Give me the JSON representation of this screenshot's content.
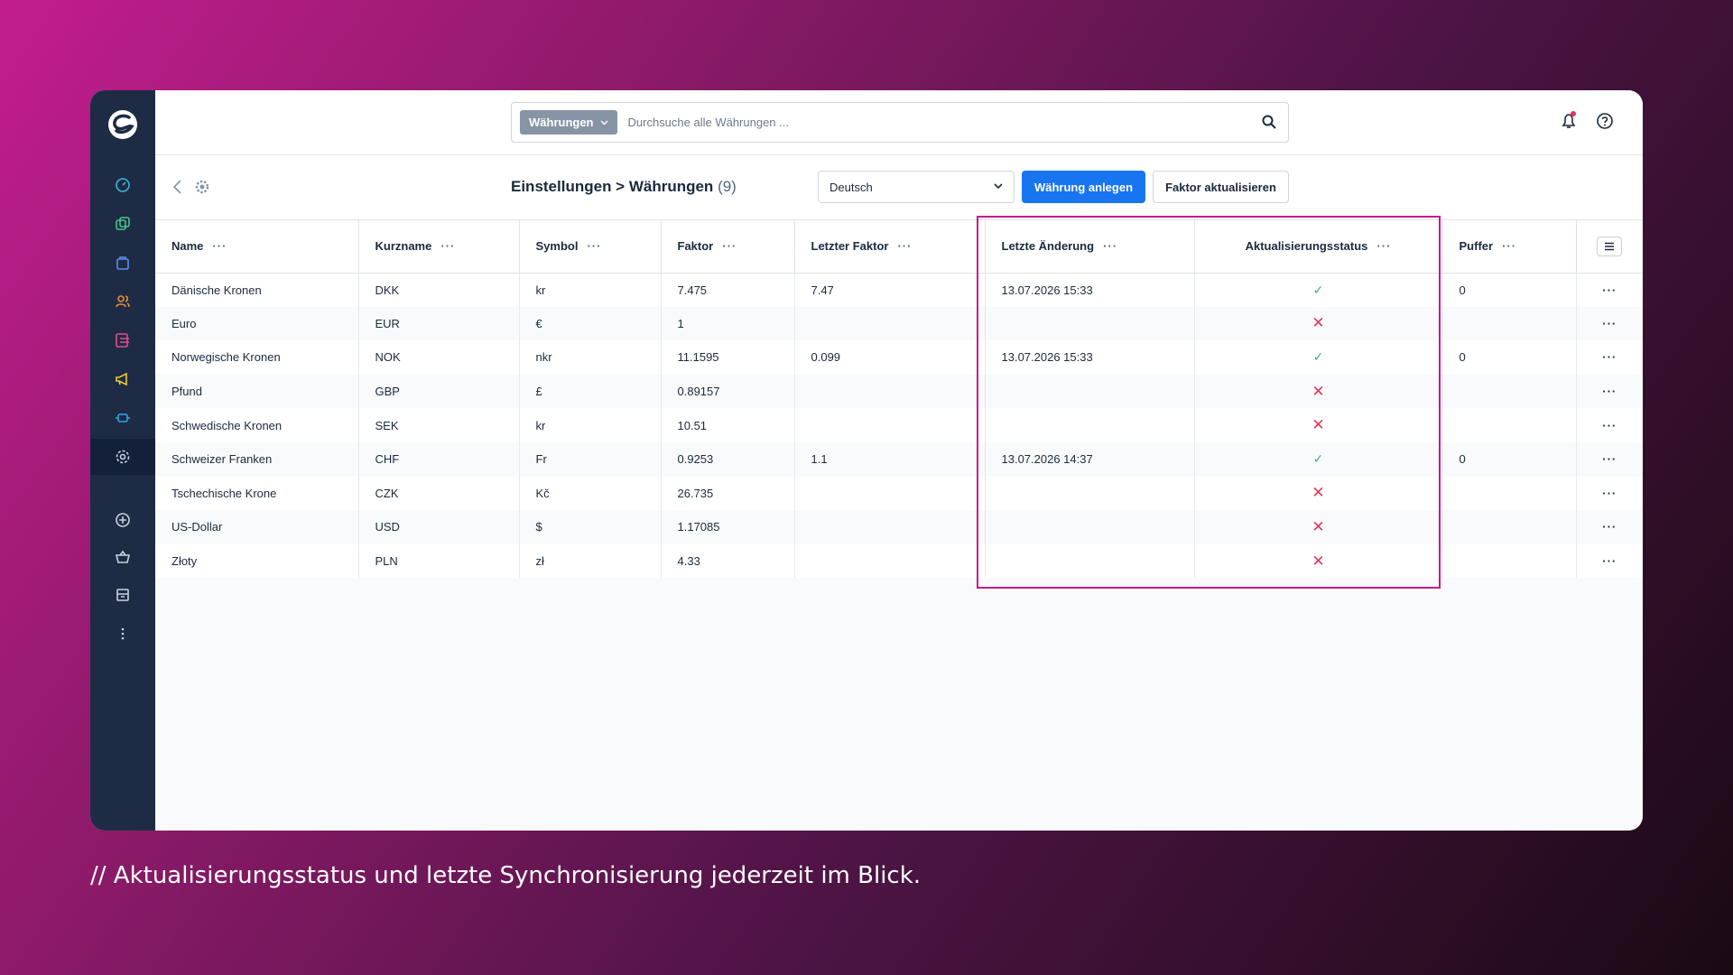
{
  "search": {
    "type_label": "Währungen",
    "placeholder": "Durchsuche alle Währungen ..."
  },
  "page": {
    "title": "Einstellungen > Währungen",
    "count": "(9)"
  },
  "language_select": {
    "value": "Deutsch"
  },
  "buttons": {
    "create": "Währung anlegen",
    "update_factor": "Faktor aktualisieren"
  },
  "table": {
    "columns": [
      "Name",
      "Kurzname",
      "Symbol",
      "Faktor",
      "Letzter Faktor",
      "Letzte Änderung",
      "Aktualisierungsstatus",
      "Puffer"
    ],
    "column_menu": "···",
    "rows": [
      {
        "name": "Dänische Kronen",
        "short": "DKK",
        "symbol": "kr",
        "factor": "7.475",
        "last_factor": "7.47",
        "last_change": "13.07.2026 15:33",
        "status": "ok",
        "buffer": "0"
      },
      {
        "name": "Euro",
        "short": "EUR",
        "symbol": "€",
        "factor": "1",
        "last_factor": "",
        "last_change": "",
        "status": "fail",
        "buffer": ""
      },
      {
        "name": "Norwegische Kronen",
        "short": "NOK",
        "symbol": "nkr",
        "factor": "11.1595",
        "last_factor": "0.099",
        "last_change": "13.07.2026 15:33",
        "status": "ok",
        "buffer": "0"
      },
      {
        "name": "Pfund",
        "short": "GBP",
        "symbol": "£",
        "factor": "0.89157",
        "last_factor": "",
        "last_change": "",
        "status": "fail",
        "buffer": ""
      },
      {
        "name": "Schwedische Kronen",
        "short": "SEK",
        "symbol": "kr",
        "factor": "10.51",
        "last_factor": "",
        "last_change": "",
        "status": "fail",
        "buffer": ""
      },
      {
        "name": "Schweizer Franken",
        "short": "CHF",
        "symbol": "Fr",
        "factor": "0.9253",
        "last_factor": "1.1",
        "last_change": "13.07.2026 14:37",
        "status": "ok",
        "buffer": "0"
      },
      {
        "name": "Tschechische Krone",
        "short": "CZK",
        "symbol": "Kč",
        "factor": "26.735",
        "last_factor": "",
        "last_change": "",
        "status": "fail",
        "buffer": ""
      },
      {
        "name": "US-Dollar",
        "short": "USD",
        "symbol": "$",
        "factor": "1.17085",
        "last_factor": "",
        "last_change": "",
        "status": "fail",
        "buffer": ""
      },
      {
        "name": "Złoty",
        "short": "PLN",
        "symbol": "zł",
        "factor": "4.33",
        "last_factor": "",
        "last_change": "",
        "status": "fail",
        "buffer": ""
      }
    ]
  },
  "status_icons": {
    "ok": "check-icon",
    "fail": "cross-icon"
  },
  "colors": {
    "sidebar": "#1d2c44",
    "primary": "#1875f0",
    "ok": "#37b56d",
    "fail": "#e0365a",
    "highlight": "#c8198b"
  },
  "caption": "//  Aktualisierungsstatus und letzte Synchronisierung jederzeit im Blick."
}
